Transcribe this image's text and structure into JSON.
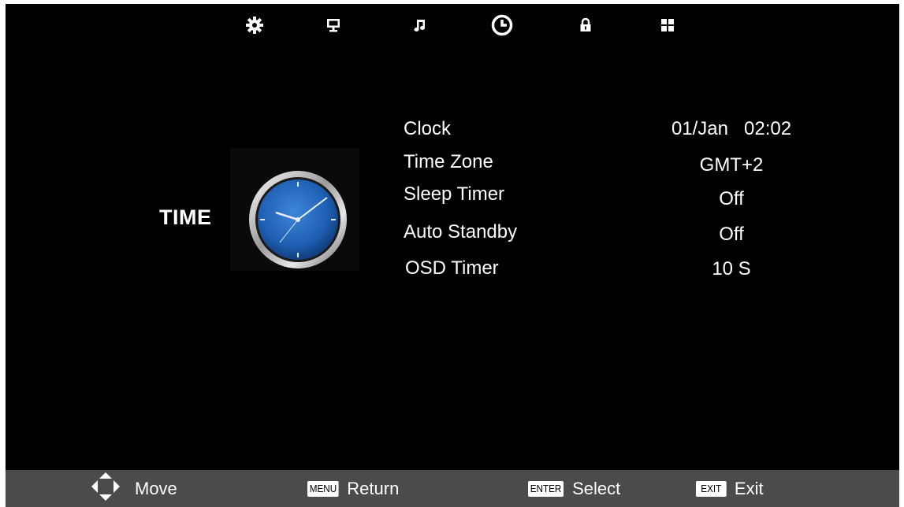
{
  "menu": {
    "tabs": [
      {
        "icon": "gear-icon"
      },
      {
        "icon": "monitor-icon"
      },
      {
        "icon": "music-note-icon"
      },
      {
        "icon": "clock-icon",
        "selected": true
      },
      {
        "icon": "lock-icon"
      },
      {
        "icon": "grid-icon"
      }
    ]
  },
  "section": {
    "title": "TIME",
    "image": "analog-clock-icon"
  },
  "settings": {
    "clock": {
      "label": "Clock",
      "value": "01/Jan   02:02"
    },
    "time_zone": {
      "label": "Time Zone",
      "value": "GMT+2"
    },
    "sleep_timer": {
      "label": "Sleep Timer",
      "value": "Off"
    },
    "auto_standby": {
      "label": "Auto Standby",
      "value": "Off"
    },
    "osd_timer": {
      "label": "OSD Timer",
      "value": "10 S"
    }
  },
  "footer": {
    "move": {
      "icon": "dpad-icon",
      "label": "Move"
    },
    "return": {
      "key": "MENU",
      "label": "Return"
    },
    "select": {
      "key": "ENTER",
      "label": "Select"
    },
    "exit": {
      "key": "EXIT",
      "label": "Exit"
    }
  },
  "colors": {
    "background": "#000000",
    "footer_background": "#4b4b4b",
    "text": "#ffffff",
    "clock_face": "#1e5fb3"
  }
}
